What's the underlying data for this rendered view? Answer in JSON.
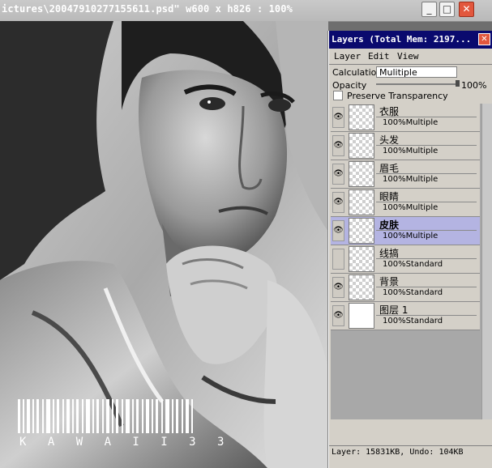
{
  "document": {
    "title": "ictures\\20047910277155611.psd\" w600 x h826 : 100%"
  },
  "window_buttons": {
    "minimize": "_",
    "maximize": "□",
    "close": "✕"
  },
  "watermark": {
    "text": "K A W A I I 3 3"
  },
  "layers_panel": {
    "title": "Layers (Total Mem: 2197...",
    "close": "✕",
    "menu": [
      "Layer",
      "Edit",
      "View"
    ],
    "calculation_label": "Calculation",
    "calculation_value": "Mulitiple",
    "opacity_label": "Opacity",
    "opacity_value": "100%",
    "preserve_label": "Preserve Transparency",
    "layers": [
      {
        "name": "衣服",
        "mode": "100%Multiple",
        "selected": false,
        "visible": true
      },
      {
        "name": "头发",
        "mode": "100%Multiple",
        "selected": false,
        "visible": true
      },
      {
        "name": "眉毛",
        "mode": "100%Multiple",
        "selected": false,
        "visible": true
      },
      {
        "name": "眼睛",
        "mode": "100%Multiple",
        "selected": false,
        "visible": true
      },
      {
        "name": "皮肤",
        "mode": "100%Multiple",
        "selected": true,
        "visible": true
      },
      {
        "name": "线搞",
        "mode": "100%Standard",
        "selected": false,
        "visible": false
      },
      {
        "name": "背景",
        "mode": "100%Standard",
        "selected": false,
        "visible": true
      },
      {
        "name": "图层 1",
        "mode": "100%Standard",
        "selected": false,
        "visible": true
      }
    ],
    "status": "Layer: 15831KB, Undo: 104KB"
  }
}
